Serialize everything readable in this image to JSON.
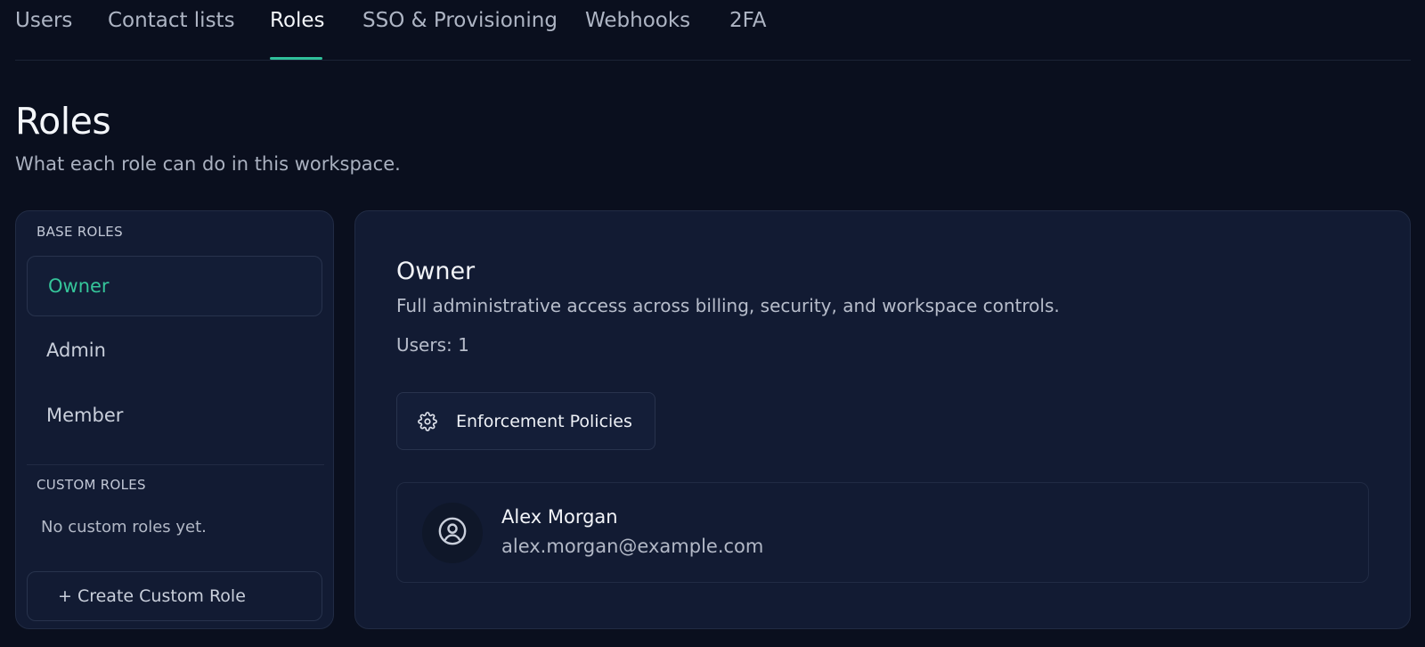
{
  "tabs": [
    {
      "label": "Users"
    },
    {
      "label": "Contact lists"
    },
    {
      "label": "Roles",
      "active": true
    },
    {
      "label": "SSO & Provisioning"
    },
    {
      "label": "Webhooks"
    },
    {
      "label": "2FA"
    }
  ],
  "page": {
    "title": "Roles",
    "subtitle": "What each role can do in this workspace."
  },
  "sidebar": {
    "base_roles_label": "BASE ROLES",
    "base_roles": [
      {
        "label": "Owner",
        "selected": true
      },
      {
        "label": "Admin"
      },
      {
        "label": "Member"
      }
    ],
    "custom_roles_label": "CUSTOM ROLES",
    "no_custom_text": "No custom roles yet.",
    "create_button_label": "+ Create Custom Role"
  },
  "detail": {
    "role_name": "Owner",
    "description": "Full administrative access across billing, security, and workspace controls.",
    "users_count_text": "Users: 1",
    "policy_button_label": "Enforcement Policies",
    "policy_icon": "gear-icon",
    "users": [
      {
        "name": "Alex Morgan",
        "email": "alex.morgan@example.com",
        "icon": "user-circle-icon"
      }
    ]
  },
  "colors": {
    "background": "#0a0f1e",
    "panel": "#121b33",
    "accent": "#2fbf9a",
    "selected_text": "#35c59a"
  }
}
